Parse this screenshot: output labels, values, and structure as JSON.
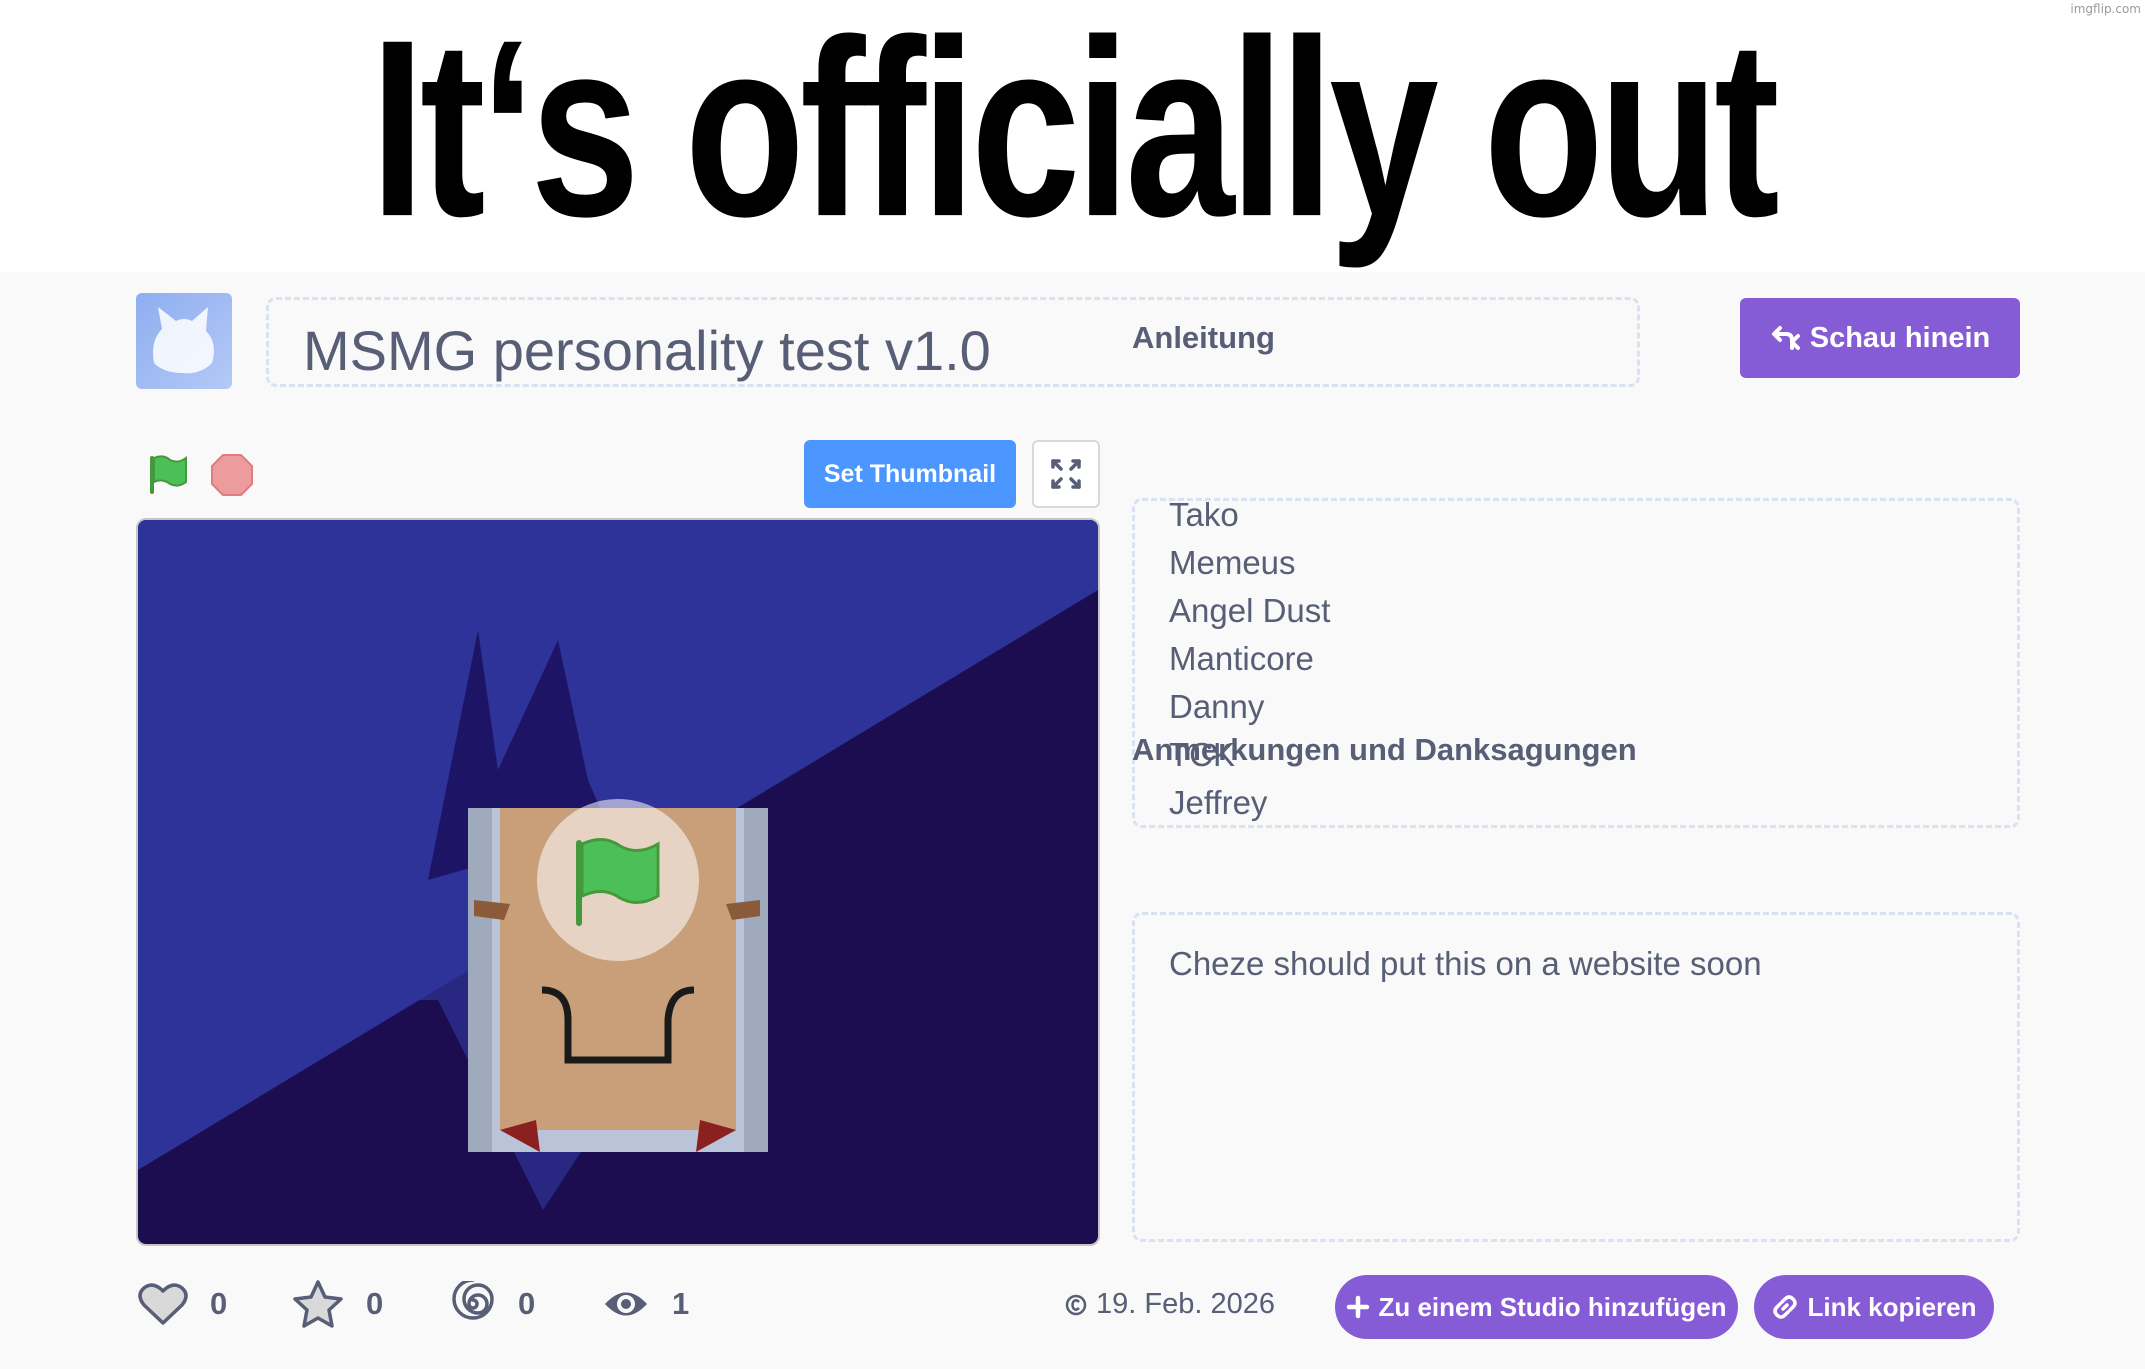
{
  "meme": {
    "caption": "It‘s officially out",
    "watermark": "imgflip.com"
  },
  "project": {
    "title": "MSMG personality test v1.0",
    "see_inside_label": "Schau hinein",
    "set_thumbnail_label": "Set Thumbnail"
  },
  "instructions": {
    "heading": "Anleitung",
    "lines": [
      "Tako",
      "Memeus",
      "Angel Dust",
      "Manticore",
      "Danny",
      "TCK",
      "Jeffrey"
    ]
  },
  "credits": {
    "heading": "Anmerkungen und Danksagungen",
    "text": "Cheze should put this on a website soon"
  },
  "stats": {
    "loves": "0",
    "favorites": "0",
    "remixes": "0",
    "views": "1"
  },
  "share_date": "19. Feb. 2026",
  "actions": {
    "add_to_studio_label": "Zu einem Studio hinzufügen",
    "copy_link_label": "Link kopieren"
  },
  "colors": {
    "accent_purple": "#855cd6",
    "thumbnail_blue": "#4c97ff",
    "text_gray": "#575e75",
    "stage_dark": "#1b0d4f",
    "stage_light": "#2e3399",
    "flag_green": "#4cbf56",
    "stop_red": "#ec9c9c"
  },
  "icons": {
    "see_inside": "remix-arrows-icon",
    "flag": "green-flag-icon",
    "stop": "stop-sign-icon",
    "fullscreen": "fullscreen-icon",
    "love": "heart-icon",
    "favorite": "star-icon",
    "remix": "spiral-icon",
    "views": "eye-icon",
    "date": "copyright-icon",
    "add": "plus-icon",
    "link": "link-icon"
  }
}
